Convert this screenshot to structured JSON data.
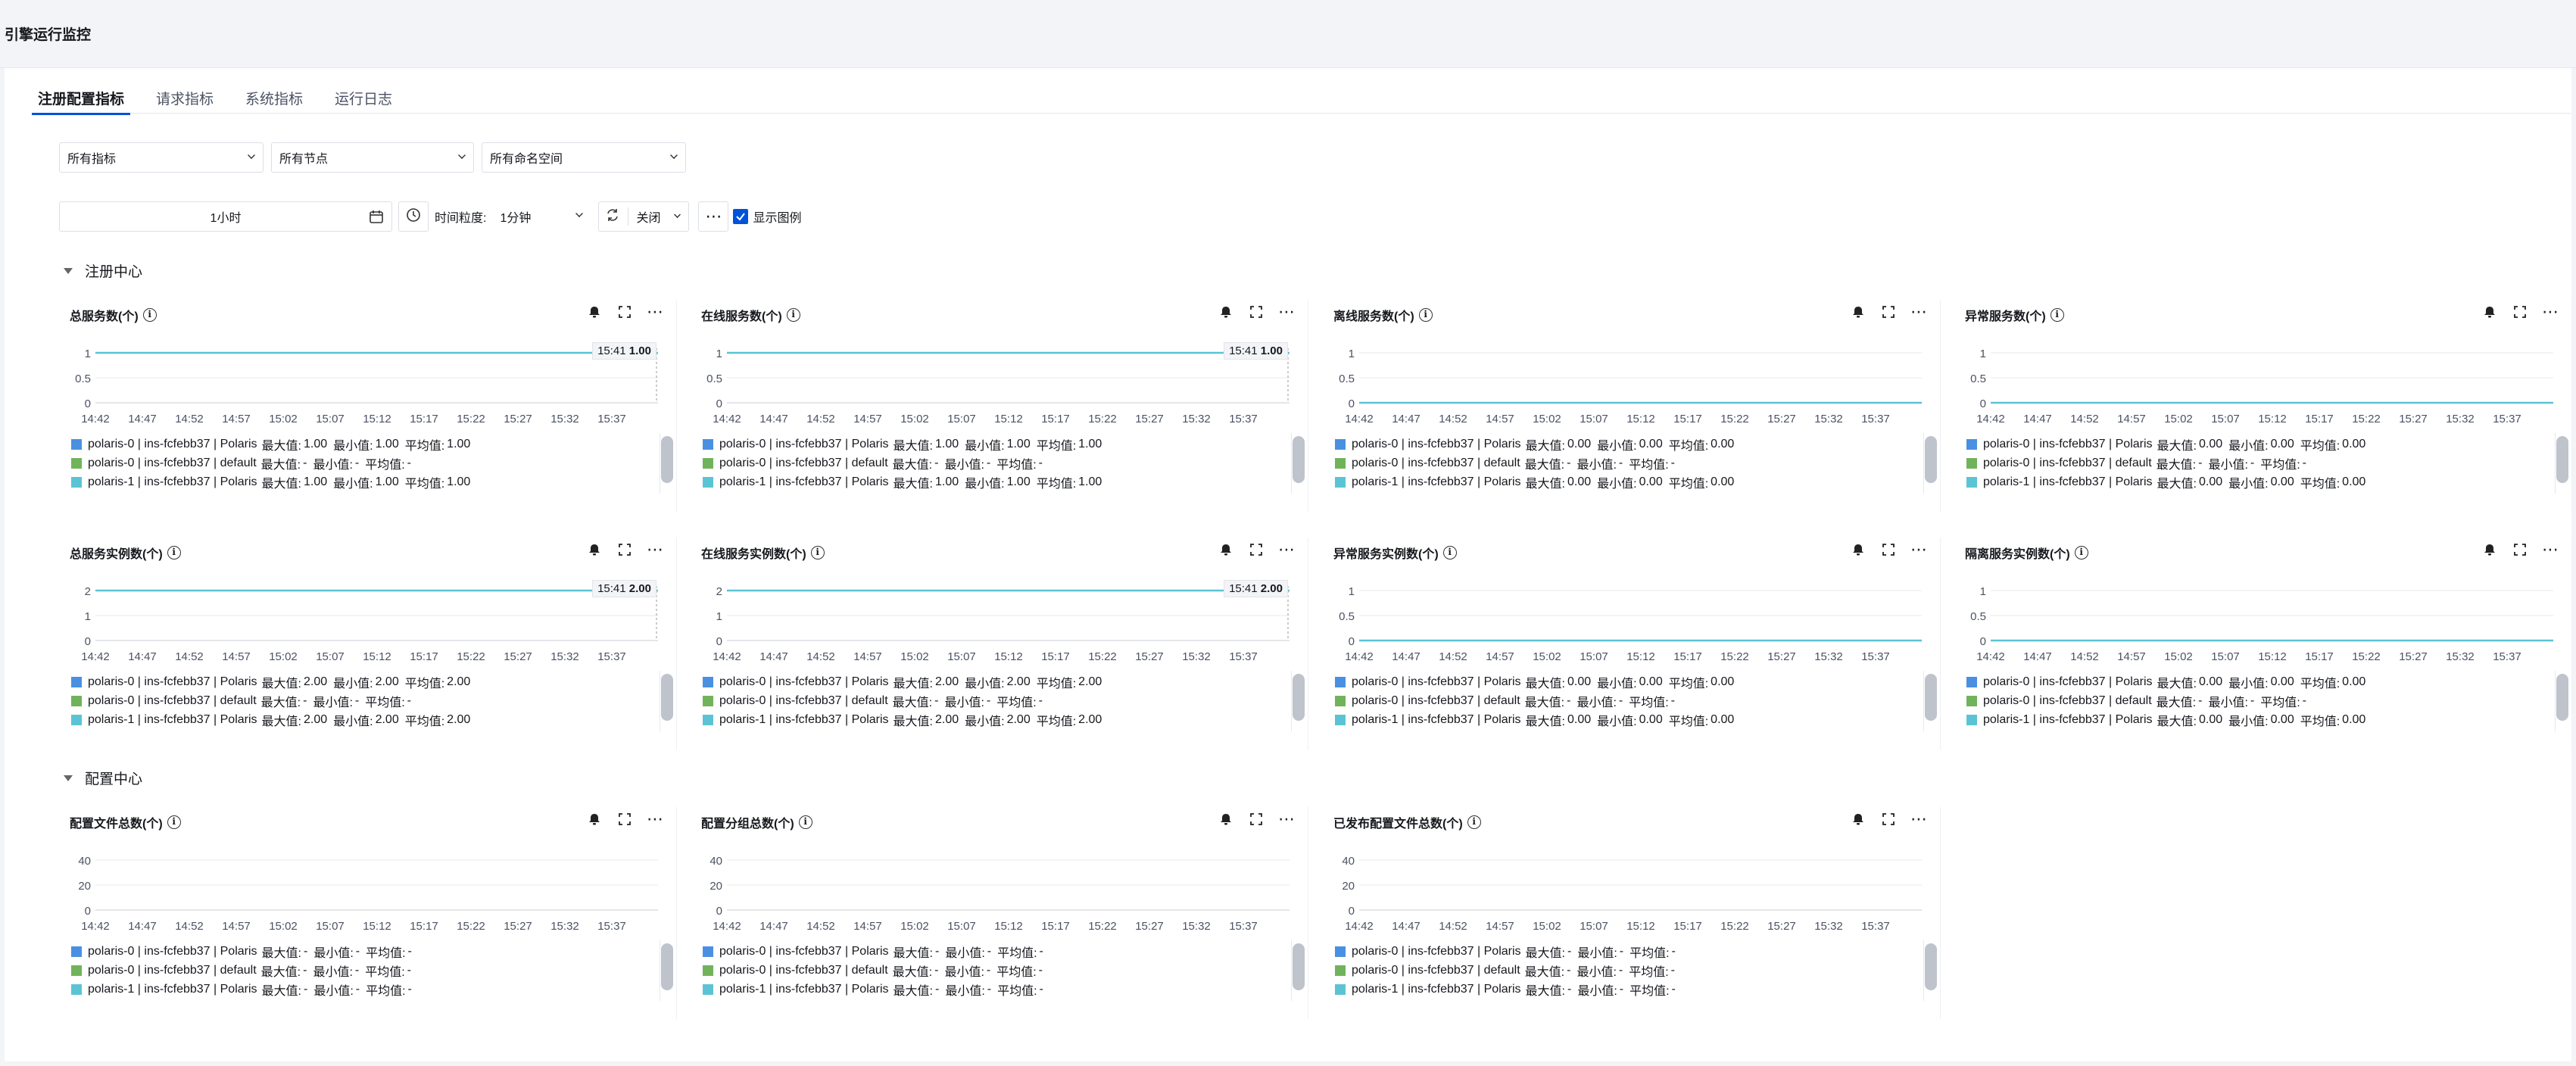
{
  "page_title": "引擎运行监控",
  "tabs": [
    {
      "label": "注册配置指标",
      "active": true
    },
    {
      "label": "请求指标",
      "active": false
    },
    {
      "label": "系统指标",
      "active": false
    },
    {
      "label": "运行日志",
      "active": false
    }
  ],
  "filters": {
    "metric": "所有指标",
    "node": "所有节点",
    "namespace": "所有命名空间"
  },
  "toolbar": {
    "time_range": "1小时",
    "granularity_label": "时间粒度:",
    "granularity": "1分钟",
    "refresh": "关闭",
    "show_legend": "显示图例",
    "show_legend_checked": true
  },
  "sections": {
    "registry": "注册中心",
    "config": "配置中心"
  },
  "colors": {
    "accent": "#0052d9",
    "series": [
      "#4a90e2",
      "#71b35b",
      "#5bc4d4"
    ]
  },
  "x_ticks": [
    "14:42",
    "14:47",
    "14:52",
    "14:57",
    "15:02",
    "15:07",
    "15:12",
    "15:17",
    "15:22",
    "15:27",
    "15:32",
    "15:37"
  ],
  "legend_rows": [
    "polaris-0 | ins-fcfebb37 | Polaris",
    "polaris-0 | ins-fcfebb37 | default",
    "polaris-1 | ins-fcfebb37 | Polaris"
  ],
  "stat_labels": {
    "max": "最大值:",
    "min": "最小值:",
    "avg": "平均值:"
  },
  "charts": [
    {
      "title": "总服务数(个)",
      "y_ticks": [
        "1",
        "0.5",
        "0"
      ],
      "ymax": 1,
      "value": 1,
      "tooltip": {
        "time": "15:41",
        "value": "1.00"
      },
      "stats": [
        [
          "1.00",
          "1.00",
          "1.00"
        ],
        [
          "-",
          "-",
          "-"
        ],
        [
          "1.00",
          "1.00",
          "1.00"
        ]
      ]
    },
    {
      "title": "在线服务数(个)",
      "y_ticks": [
        "1",
        "0.5",
        "0"
      ],
      "ymax": 1,
      "value": 1,
      "tooltip": {
        "time": "15:41",
        "value": "1.00"
      },
      "stats": [
        [
          "1.00",
          "1.00",
          "1.00"
        ],
        [
          "-",
          "-",
          "-"
        ],
        [
          "1.00",
          "1.00",
          "1.00"
        ]
      ]
    },
    {
      "title": "离线服务数(个)",
      "y_ticks": [
        "1",
        "0.5",
        "0"
      ],
      "ymax": 1,
      "value": 0,
      "tooltip": null,
      "stats": [
        [
          "0.00",
          "0.00",
          "0.00"
        ],
        [
          "-",
          "-",
          "-"
        ],
        [
          "0.00",
          "0.00",
          "0.00"
        ]
      ]
    },
    {
      "title": "异常服务数(个)",
      "y_ticks": [
        "1",
        "0.5",
        "0"
      ],
      "ymax": 1,
      "value": 0,
      "tooltip": null,
      "stats": [
        [
          "0.00",
          "0.00",
          "0.00"
        ],
        [
          "-",
          "-",
          "-"
        ],
        [
          "0.00",
          "0.00",
          "0.00"
        ]
      ]
    },
    {
      "title": "总服务实例数(个)",
      "y_ticks": [
        "2",
        "1",
        "0"
      ],
      "ymax": 2,
      "value": 2,
      "tooltip": {
        "time": "15:41",
        "value": "2.00"
      },
      "stats": [
        [
          "2.00",
          "2.00",
          "2.00"
        ],
        [
          "-",
          "-",
          "-"
        ],
        [
          "2.00",
          "2.00",
          "2.00"
        ]
      ]
    },
    {
      "title": "在线服务实例数(个)",
      "y_ticks": [
        "2",
        "1",
        "0"
      ],
      "ymax": 2,
      "value": 2,
      "tooltip": {
        "time": "15:41",
        "value": "2.00"
      },
      "stats": [
        [
          "2.00",
          "2.00",
          "2.00"
        ],
        [
          "-",
          "-",
          "-"
        ],
        [
          "2.00",
          "2.00",
          "2.00"
        ]
      ]
    },
    {
      "title": "异常服务实例数(个)",
      "y_ticks": [
        "1",
        "0.5",
        "0"
      ],
      "ymax": 1,
      "value": 0,
      "tooltip": null,
      "stats": [
        [
          "0.00",
          "0.00",
          "0.00"
        ],
        [
          "-",
          "-",
          "-"
        ],
        [
          "0.00",
          "0.00",
          "0.00"
        ]
      ]
    },
    {
      "title": "隔离服务实例数(个)",
      "y_ticks": [
        "1",
        "0.5",
        "0"
      ],
      "ymax": 1,
      "value": 0,
      "tooltip": null,
      "stats": [
        [
          "0.00",
          "0.00",
          "0.00"
        ],
        [
          "-",
          "-",
          "-"
        ],
        [
          "0.00",
          "0.00",
          "0.00"
        ]
      ]
    },
    {
      "title": "配置文件总数(个)",
      "y_ticks": [
        "40",
        "20",
        "0"
      ],
      "ymax": 40,
      "value": null,
      "tooltip": null,
      "stats": [
        [
          "-",
          "-",
          "-"
        ],
        [
          "-",
          "-",
          "-"
        ],
        [
          "-",
          "-",
          "-"
        ]
      ]
    },
    {
      "title": "配置分组总数(个)",
      "y_ticks": [
        "40",
        "20",
        "0"
      ],
      "ymax": 40,
      "value": null,
      "tooltip": null,
      "stats": [
        [
          "-",
          "-",
          "-"
        ],
        [
          "-",
          "-",
          "-"
        ],
        [
          "-",
          "-",
          "-"
        ]
      ]
    },
    {
      "title": "已发布配置文件总数(个)",
      "y_ticks": [
        "40",
        "20",
        "0"
      ],
      "ymax": 40,
      "value": null,
      "tooltip": null,
      "stats": [
        [
          "-",
          "-",
          "-"
        ],
        [
          "-",
          "-",
          "-"
        ],
        [
          "-",
          "-",
          "-"
        ]
      ]
    }
  ]
}
